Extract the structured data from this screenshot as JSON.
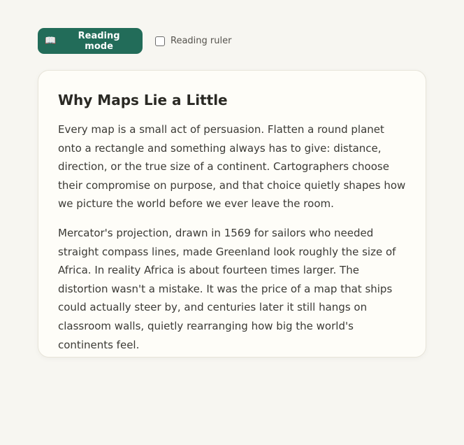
{
  "toolbar": {
    "reading_mode_label": "Reading mode",
    "reading_mode_icon": "open-book-icon",
    "reading_ruler_label": "Reading ruler",
    "reading_ruler_checked": false
  },
  "article": {
    "title": "Why Maps Lie a Little",
    "paragraphs": [
      "Every map is a small act of persuasion. Flatten a round planet onto a rectangle and something always has to give: distance, direction, or the true size of a continent. Cartographers choose their compromise on purpose, and that choice quietly shapes how we picture the world before we ever leave the room.",
      "Mercator's projection, drawn in 1569 for sailors who needed straight compass lines, made Greenland look roughly the size of Africa. In reality Africa is about fourteen times larger. The distortion wasn't a mistake. It was the price of a map that ships could actually steer by, and centuries later it still hangs on classroom walls, quietly rearranging how big the world's continents feel."
    ]
  },
  "colors": {
    "page_background": "#f7f6f1",
    "card_background": "#fefdf8",
    "accent": "#226c59",
    "text": "#3b3a35"
  }
}
